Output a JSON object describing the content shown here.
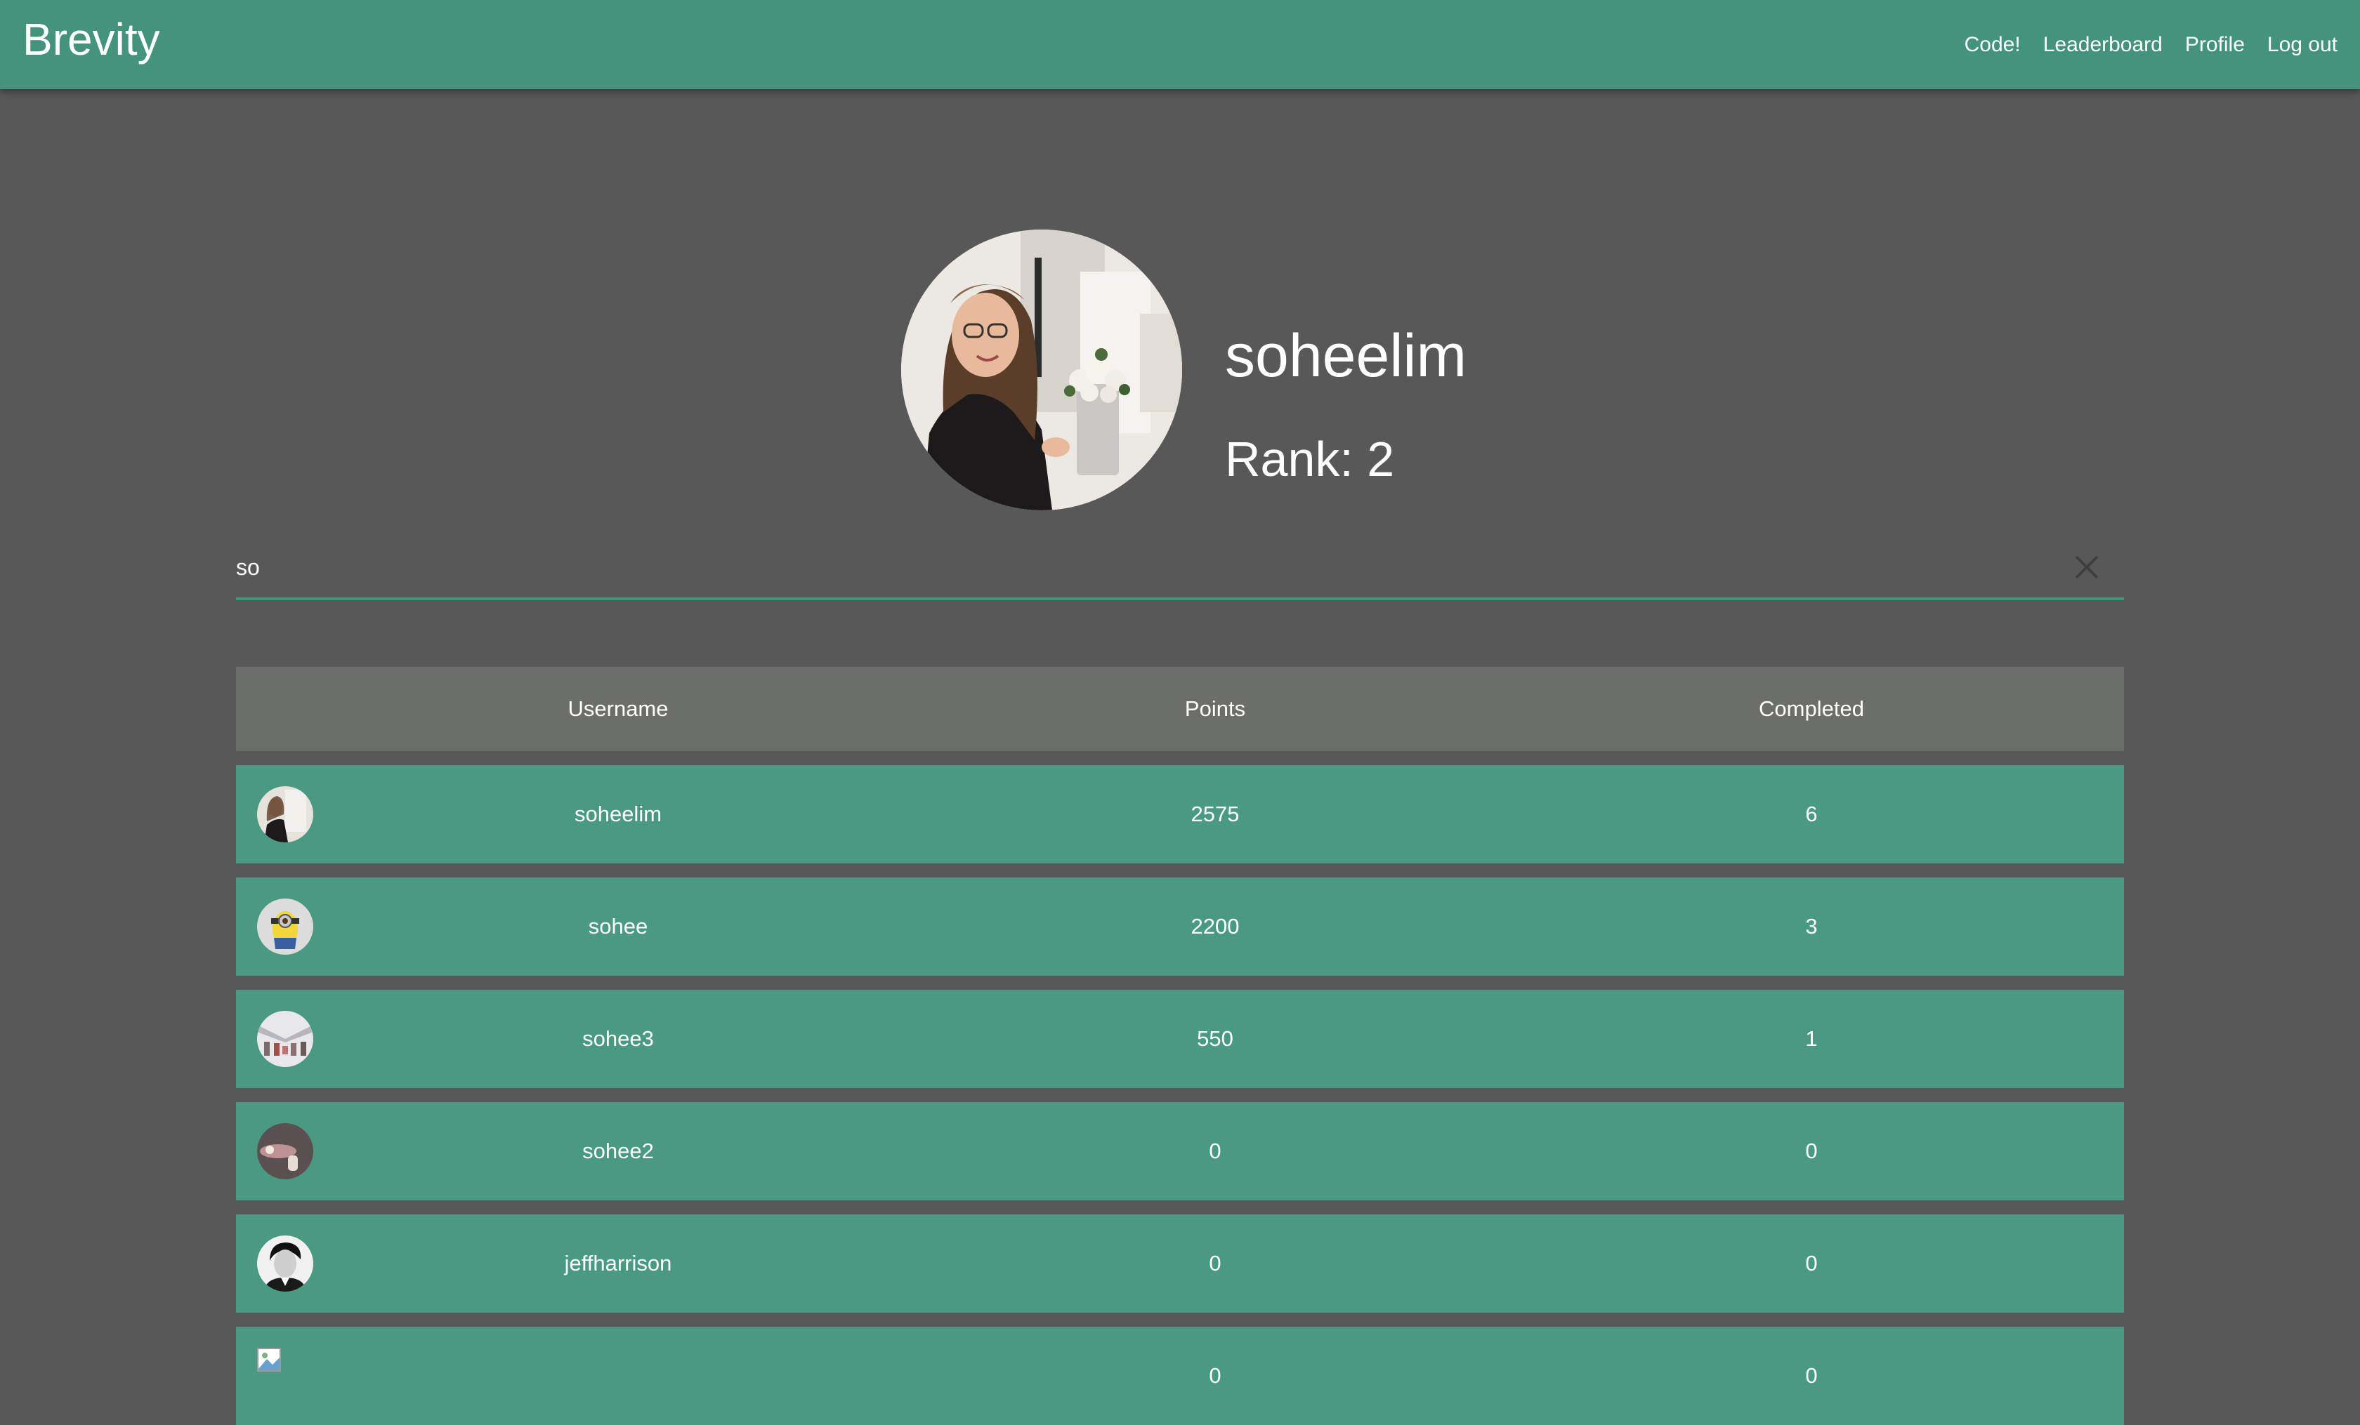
{
  "navbar": {
    "brand": "Brevity",
    "links": [
      "Code!",
      "Leaderboard",
      "Profile",
      "Log out"
    ]
  },
  "profile": {
    "username": "soheelim",
    "rank": "Rank: 2"
  },
  "search": {
    "value": "so",
    "clear_icon": "close-icon"
  },
  "table": {
    "headers": [
      "Username",
      "Points",
      "Completed"
    ],
    "rows": [
      {
        "username": "soheelim",
        "points": "2575",
        "completed": "6"
      },
      {
        "username": "sohee",
        "points": "2200",
        "completed": "3"
      },
      {
        "username": "sohee3",
        "points": "550",
        "completed": "1"
      },
      {
        "username": "sohee2",
        "points": "0",
        "completed": "0"
      },
      {
        "username": "jeffharrison",
        "points": "0",
        "completed": "0"
      },
      {
        "username": "",
        "points": "0",
        "completed": "0"
      }
    ]
  },
  "colors": {
    "accent": "#44947c",
    "row": "#4a9a82",
    "header": "#6b6e69",
    "background": "#585858"
  }
}
